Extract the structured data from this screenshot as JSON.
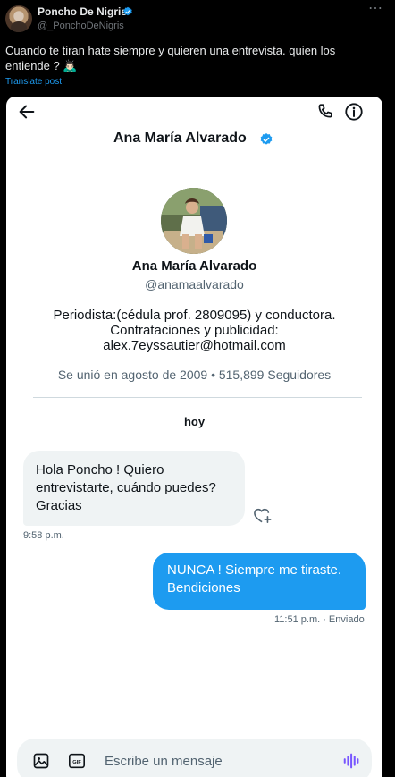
{
  "post": {
    "author_name": "Poncho De Nigris",
    "author_handle": "@_PonchoDeNigris",
    "text": "Cuando te tiran hate siempre y quieren una entrevista. quien los entiende ? 🙇🏻‍♂️",
    "translate_label": "Translate post",
    "more_icon": "more-icon",
    "verified_icon": "verified-badge-icon"
  },
  "dm": {
    "title": "Ana María Alvarado",
    "profile": {
      "name": "Ana María Alvarado",
      "handle": "@anamaalvarado",
      "bio_line1": "Periodista:(cédula prof. 2809095) y conductora.",
      "bio_line2": "Contrataciones y publicidad:",
      "bio_line3": "alex.7eyssautier@hotmail.com",
      "meta": "Se unió en agosto de 2009 • 515,899 Seguidores"
    },
    "day": "hoy",
    "messages": [
      {
        "direction": "incoming",
        "text": "Hola Poncho ! Quiero entrevistarte, cuándo puedes? Gracias",
        "time": "9:58 p.m."
      },
      {
        "direction": "outgoing",
        "text": "NUNCA ! Siempre me tiraste. Bendiciones",
        "time": "11:51 p.m. · Enviado"
      }
    ],
    "composer": {
      "placeholder": "Escribe un mensaje"
    }
  },
  "colors": {
    "accent": "#1d9bf0",
    "background": "#000000",
    "card": "#ffffff",
    "bubble_incoming": "#eff3f4",
    "voice": "#7856ff"
  }
}
